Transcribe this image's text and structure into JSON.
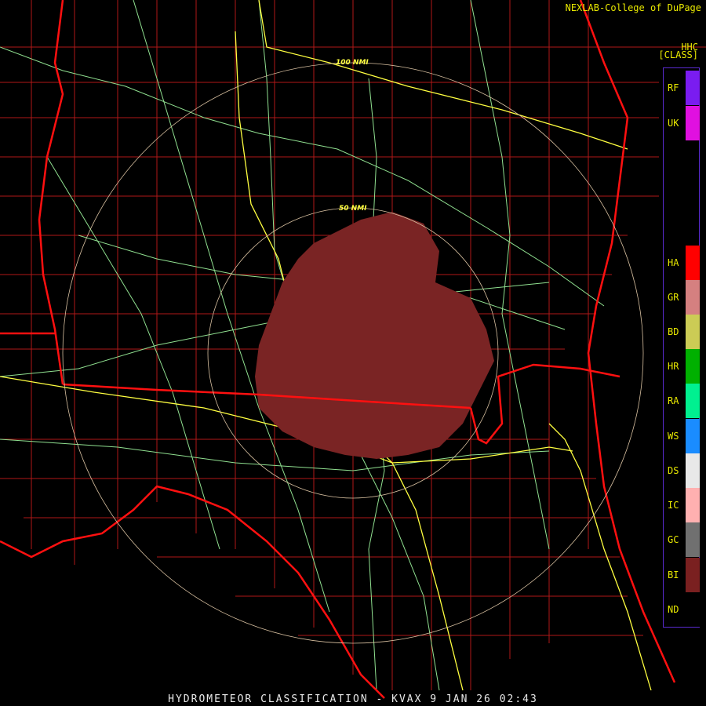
{
  "credit": "NEXLAB-College of DuPage",
  "product_code": "HHC",
  "product_class": "[CLASS]",
  "footer": "HYDROMETEOR CLASSIFICATION - KVAX 9 JAN 26 02:43",
  "range_rings": [
    "100 NMI",
    "50 NMI"
  ],
  "legend": [
    {
      "code": "RF",
      "color": "#7a1cf0"
    },
    {
      "code": "UK",
      "color": "#e010e0"
    },
    {
      "code": "HA",
      "color": "#ff0000"
    },
    {
      "code": "GR",
      "color": "#d58080"
    },
    {
      "code": "BD",
      "color": "#cccc55"
    },
    {
      "code": "HR",
      "color": "#00b000"
    },
    {
      "code": "RA",
      "color": "#00f090"
    },
    {
      "code": "WS",
      "color": "#1a8cff"
    },
    {
      "code": "DS",
      "color": "#e8e8e8"
    },
    {
      "code": "IC",
      "color": "#ffb0b0"
    },
    {
      "code": "GC",
      "color": "#707070"
    },
    {
      "code": "BI",
      "color": "#7a2020"
    },
    {
      "code": "ND",
      "color": "#000000"
    }
  ],
  "colors": {
    "background": "#000000",
    "state_border": "#ff1010",
    "county_border": "#b01818",
    "interstate": "#ffff40",
    "highway": "#90e090",
    "range_ring": "#d8c0a0",
    "echo": "#7a2424"
  }
}
